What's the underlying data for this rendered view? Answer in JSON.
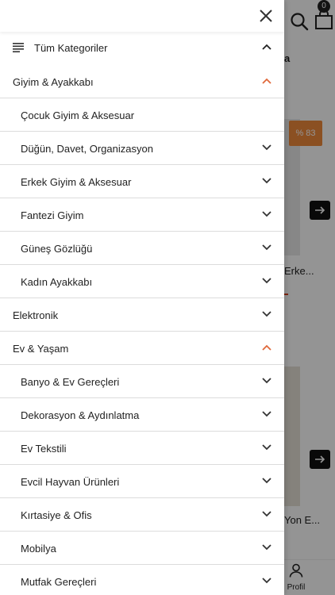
{
  "background": {
    "cart_count": "0",
    "tab_fragment": "a",
    "discount_badge": "% 83",
    "product_titles": [
      "Erke...",
      "Yon E..."
    ],
    "profile_label": "Profil",
    "accent_color": "#f08a3c"
  },
  "drawer": {
    "all_categories_label": "Tüm Kategoriler",
    "rows": [
      {
        "label": "Giyim & Ayakkabı",
        "level": "parent",
        "expanded": true
      },
      {
        "label": "Çocuk Giyim & Aksesuar",
        "level": "child",
        "expanded": false,
        "chevron": false
      },
      {
        "label": "Düğün, Davet, Organizasyon",
        "level": "child",
        "expanded": false
      },
      {
        "label": "Erkek Giyim & Aksesuar",
        "level": "child",
        "expanded": false
      },
      {
        "label": "Fantezi Giyim",
        "level": "child",
        "expanded": false
      },
      {
        "label": "Güneş Gözlüğü",
        "level": "child",
        "expanded": false
      },
      {
        "label": "Kadın Ayakkabı",
        "level": "child",
        "expanded": false
      },
      {
        "label": "Elektronik",
        "level": "parent",
        "expanded": false
      },
      {
        "label": "Ev & Yaşam",
        "level": "parent",
        "expanded": true
      },
      {
        "label": "Banyo & Ev Gereçleri",
        "level": "child",
        "expanded": false
      },
      {
        "label": "Dekorasyon & Aydınlatma",
        "level": "child",
        "expanded": false
      },
      {
        "label": "Ev Tekstili",
        "level": "child",
        "expanded": false
      },
      {
        "label": "Evcil Hayvan Ürünleri",
        "level": "child",
        "expanded": false
      },
      {
        "label": "Kırtasiye & Ofis",
        "level": "child",
        "expanded": false
      },
      {
        "label": "Mobilya",
        "level": "child",
        "expanded": false
      },
      {
        "label": "Mutfak Gereçleri",
        "level": "child",
        "expanded": false
      }
    ]
  },
  "colors": {
    "expanded_chevron": "#e0683a",
    "chevron": "#333333",
    "divider": "#dcdcdc"
  }
}
